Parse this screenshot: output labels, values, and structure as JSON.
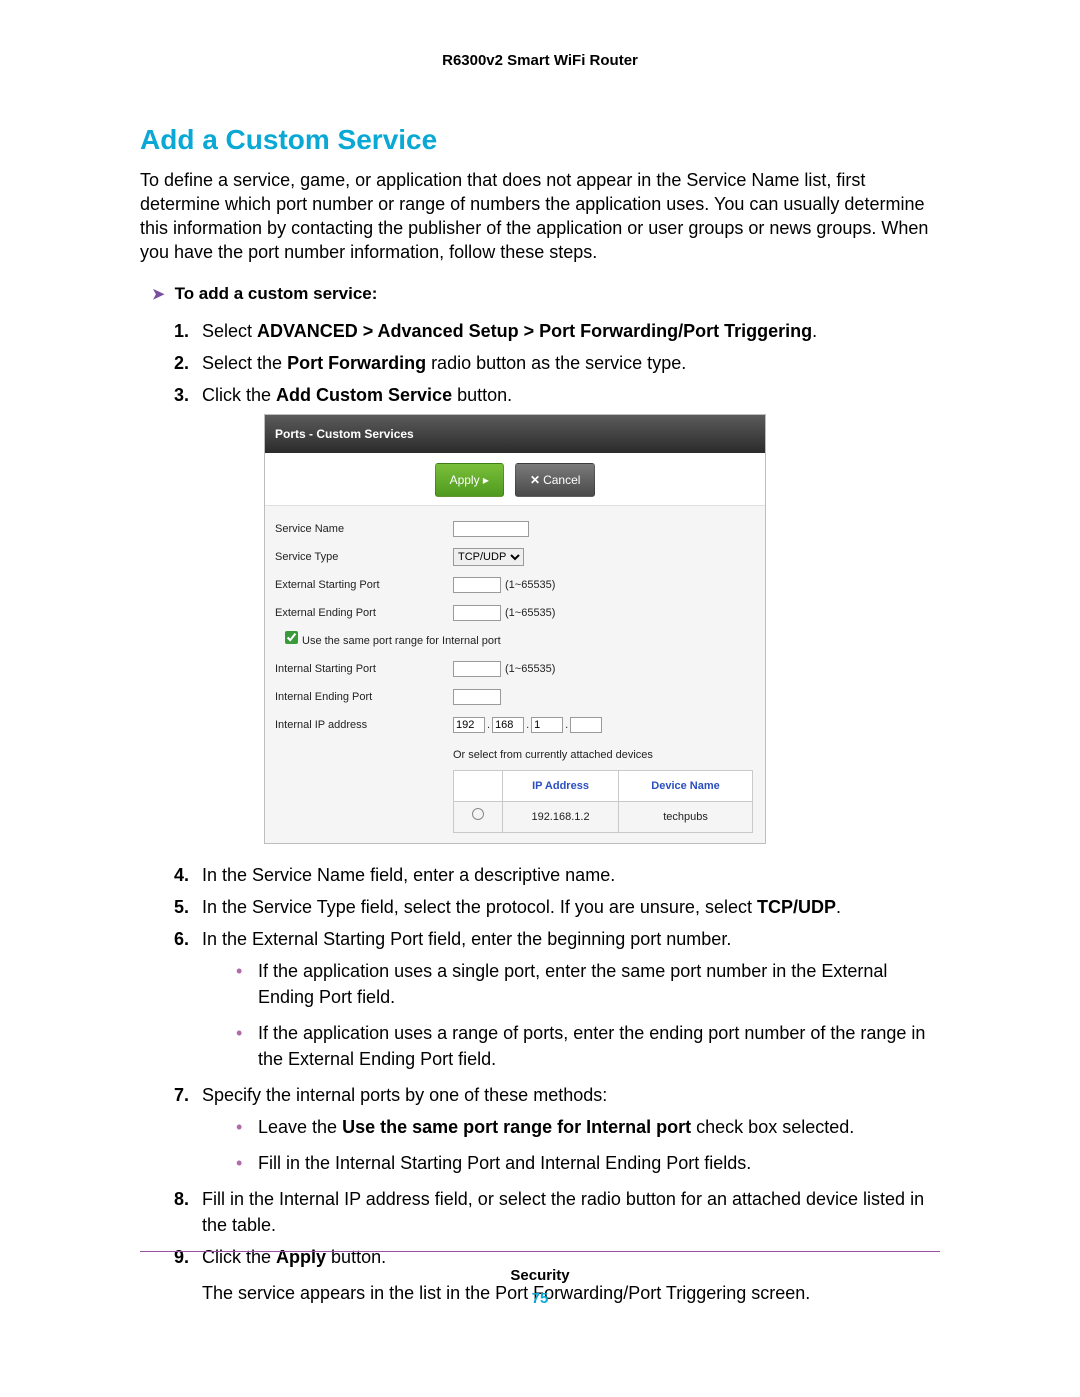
{
  "header": {
    "product": "R6300v2 Smart WiFi Router"
  },
  "title": "Add a Custom Service",
  "intro": "To define a service, game, or application that does not appear in the Service Name list, first determine which port number or range of numbers the application uses. You can usually determine this information by contacting the publisher of the application or user groups or news groups. When you have the port number information, follow these steps.",
  "procedure_heading": "To add a custom service:",
  "steps": {
    "s1_pre": "Select ",
    "s1_bold": "ADVANCED > Advanced Setup > Port Forwarding/Port Triggering",
    "s1_post": ".",
    "s2_pre": "Select the ",
    "s2_bold": "Port Forwarding",
    "s2_post": " radio button as the service type.",
    "s3_pre": "Click the ",
    "s3_bold": "Add Custom Service",
    "s3_post": " button.",
    "s4": "In the Service Name field, enter a descriptive name.",
    "s5_pre": "In the Service Type field, select the protocol. If you are unsure, select ",
    "s5_bold": "TCP/UDP",
    "s5_post": ".",
    "s6": "In the External Starting Port field, enter the beginning port number.",
    "s6b1": "If the application uses a single port, enter the same port number in the External Ending Port field.",
    "s6b2": "If the application uses a range of ports, enter the ending port number of the range in the External Ending Port field.",
    "s7": "Specify the internal ports by one of these methods:",
    "s7b1_pre": "Leave the ",
    "s7b1_bold": "Use the same port range for Internal port",
    "s7b1_post": " check box selected.",
    "s7b2": "Fill in the Internal Starting Port and Internal Ending Port fields.",
    "s8": "Fill in the Internal IP address field, or select the radio button for an attached device listed in the table.",
    "s9_pre": "Click the ",
    "s9_bold": "Apply",
    "s9_post": " button.",
    "s9_result": "The service appears in the list in the Port Forwarding/Port Triggering screen."
  },
  "screenshot": {
    "title": "Ports - Custom Services",
    "apply_label": "Apply ▸",
    "cancel_label": "Cancel",
    "labels": {
      "service_name": "Service Name",
      "service_type": "Service Type",
      "ext_start": "External Starting Port",
      "ext_end": "External Ending Port",
      "use_same": "Use the same port range for Internal port",
      "int_start": "Internal Starting Port",
      "int_end": "Internal Ending Port",
      "int_ip": "Internal IP address",
      "or_select": "Or select from currently attached devices"
    },
    "service_type_value": "TCP/UDP",
    "port_hint": "(1~65535)",
    "ip": {
      "a": "192",
      "b": "168",
      "c": "1",
      "d": ""
    },
    "table": {
      "h1": "IP Address",
      "h2": "Device Name",
      "row": {
        "ip": "192.168.1.2",
        "name": "techpubs"
      }
    }
  },
  "footer": {
    "section": "Security",
    "page": "75"
  }
}
